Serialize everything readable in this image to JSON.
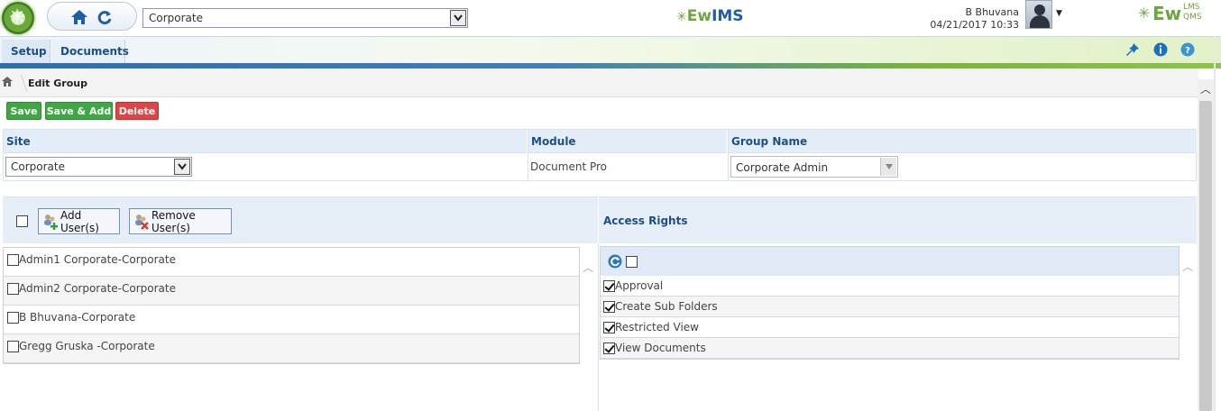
{
  "header": {
    "site_select_value": "Corporate",
    "brand_center": {
      "ew": "Ew",
      "ims": "IMS"
    },
    "brand_right": {
      "ew": "Ew",
      "lms": "LMS",
      "qms": "QMS"
    },
    "user": {
      "name": "B Bhuvana",
      "datetime": "04/21/2017 10:33"
    }
  },
  "menu": {
    "tabs": [
      {
        "label": "Setup"
      },
      {
        "label": "Documents"
      }
    ],
    "icons": [
      "pin-icon",
      "info-icon",
      "help-icon"
    ]
  },
  "breadcrumb": {
    "title": "Edit Group"
  },
  "actions": {
    "save": "Save",
    "save_add": "Save & Add",
    "delete": "Delete"
  },
  "form": {
    "site_label": "Site",
    "module_label": "Module",
    "group_label": "Group Name",
    "site_value": "Corporate",
    "module_value": "Document Pro",
    "group_value": "Corporate Admin"
  },
  "users": {
    "add_label": "Add User(s)",
    "remove_label": "Remove User(s)",
    "rows": [
      {
        "name": "Admin1 Corporate-Corporate",
        "checked": false
      },
      {
        "name": "Admin2 Corporate-Corporate",
        "checked": false
      },
      {
        "name": "B Bhuvana-Corporate",
        "checked": false
      },
      {
        "name": "Gregg Gruska -Corporate",
        "checked": false
      }
    ]
  },
  "access_rights": {
    "title": "Access Rights",
    "rows": [
      {
        "name": "Approval",
        "checked": true
      },
      {
        "name": "Create Sub Folders",
        "checked": true
      },
      {
        "name": "Restricted View",
        "checked": true
      },
      {
        "name": "View Documents",
        "checked": true
      }
    ]
  },
  "colors": {
    "save": "#3fa844",
    "delete": "#e04545",
    "header_blue": "#1d4f86"
  }
}
